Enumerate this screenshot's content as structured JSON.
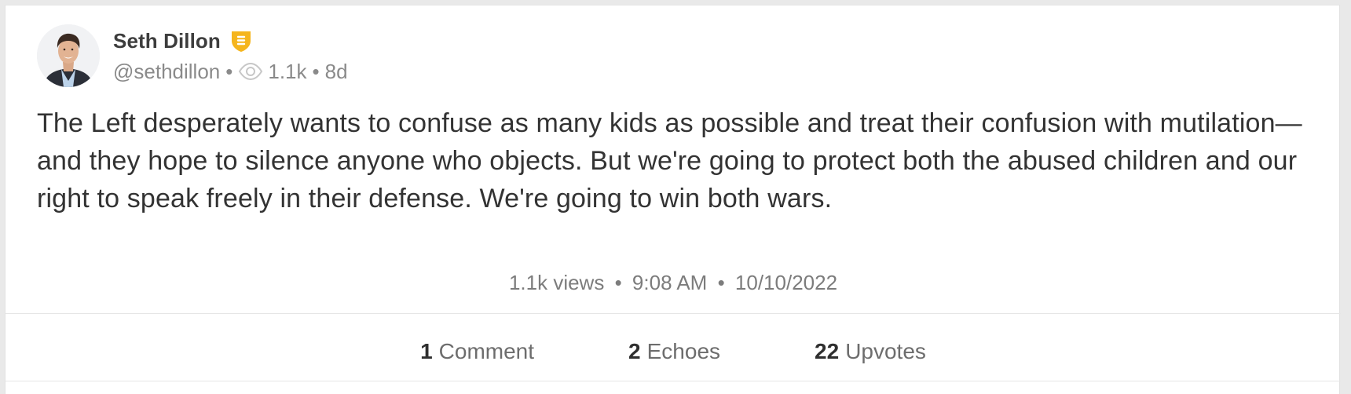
{
  "post": {
    "author": {
      "display_name": "Seth Dillon",
      "handle": "@sethdillon",
      "badge_icon": "verified-shield-icon",
      "badge_color": "#f5b51e"
    },
    "header_meta": {
      "separator": "•",
      "views_icon": "eye-icon",
      "views": "1.1k",
      "age": "8d"
    },
    "text": "The Left desperately wants to confuse as many kids as possible and treat their confusion with mutilation—and they hope to silence anyone who objects. But we're going to protect both the abused children and our right to speak freely in their defense. We're going to win both wars.",
    "footer_meta": {
      "views": "1.1k views",
      "time": "9:08 AM",
      "date": "10/10/2022",
      "separator": "•"
    },
    "stats": [
      {
        "count": "1",
        "label": "Comment"
      },
      {
        "count": "2",
        "label": "Echoes"
      },
      {
        "count": "22",
        "label": "Upvotes"
      }
    ]
  },
  "colors": {
    "text_primary": "#333333",
    "text_muted": "#8a8a8a",
    "card_bg": "#ffffff",
    "page_bg": "#e9e9e9"
  }
}
